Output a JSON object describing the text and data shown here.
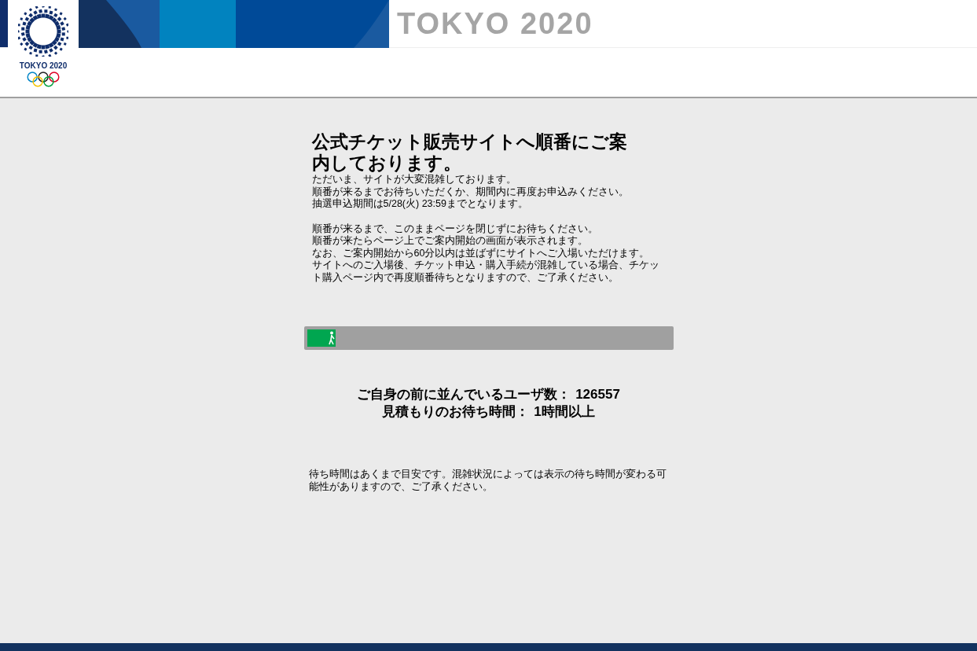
{
  "header": {
    "logo_text": "TOKYO 2020",
    "banner_title": "TOKYO 2020"
  },
  "main": {
    "title": "公式チケット販売サイトへ順番にご案内しております。",
    "paragraphs": [
      [
        "ただいま、サイトが大変混雑しております。",
        "順番が来るまでお待ちいただくか、期間内に再度お申込みください。",
        "抽選申込期間は5/28(火) 23:59までとなります。"
      ],
      [
        "順番が来るまで、このままページを閉じずにお待ちください。",
        "順番が来たらページ上でご案内開始の画面が表示されます。",
        "なお、ご案内開始から60分以内は並ばずにサイトへご入場いただけます。",
        "サイトへのご入場後、チケット申込・購入手続が混雑している場合、チケット購入ページ内で再度順番待ちとなりますので、ご了承ください。"
      ]
    ],
    "progress": {
      "level": 0.08
    },
    "stats": [
      {
        "label": "ご自身の前に並んでいるユーザ数：",
        "value": "126557"
      },
      {
        "label": "見積もりのお待ち時間：",
        "value": "1時間以上"
      }
    ],
    "note": "待ち時間はあくまで目安です。混雑状況によっては表示の待ち時間が変わる可能性がありますので、ご了承ください。"
  }
}
